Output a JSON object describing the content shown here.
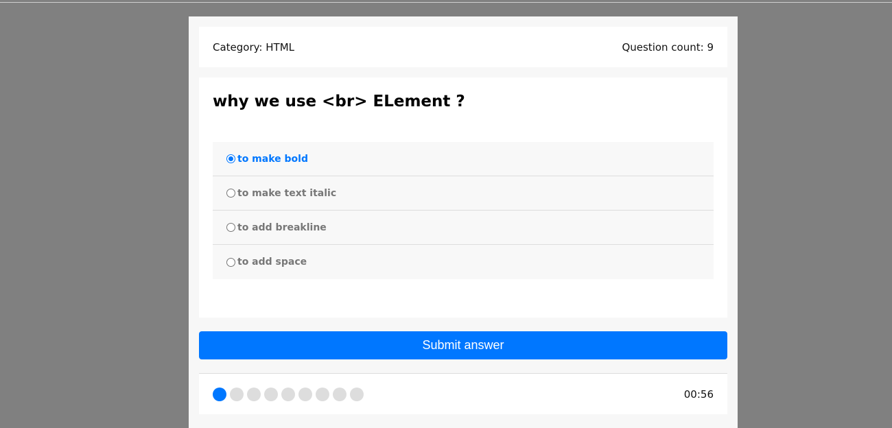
{
  "header": {
    "category": "Category: HTML",
    "question_count": "Question count: 9"
  },
  "question": {
    "title": "why we use <br> ELement ?",
    "options": [
      {
        "label": "to make bold",
        "selected": true
      },
      {
        "label": "to make text italic",
        "selected": false
      },
      {
        "label": "to add breakline",
        "selected": false
      },
      {
        "label": "to add space",
        "selected": false
      }
    ]
  },
  "submit_label": "Submit answer",
  "progress": {
    "total": 9,
    "current": 1
  },
  "timer": "00:56",
  "colors": {
    "accent": "#0077ff",
    "background": "#808080"
  }
}
